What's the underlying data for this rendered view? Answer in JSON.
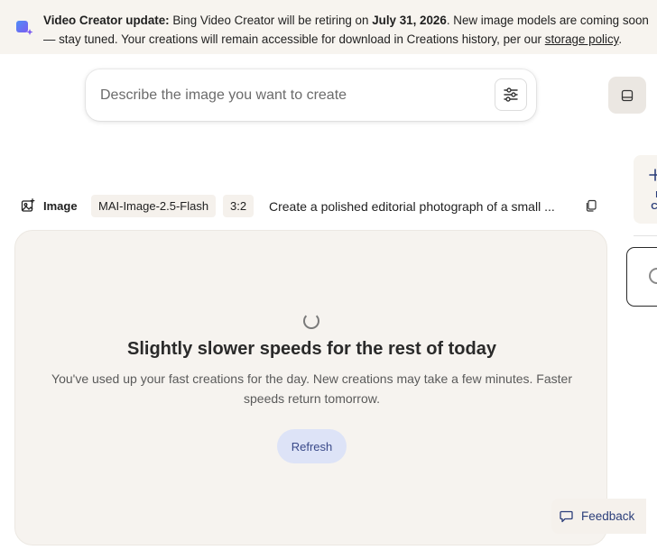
{
  "banner": {
    "bold_lead": "Video Creator update:",
    "text_part1": " Bing Video Creator will be retiring on ",
    "date": "July 31, 2026",
    "text_part2": ". New image models are coming soon — stay tuned. Your creations will remain accessible for download in Creations history, per our ",
    "link_text": "storage policy",
    "text_end": "."
  },
  "prompt": {
    "placeholder": "Describe the image you want to create"
  },
  "creation": {
    "type_label": "Image",
    "model": "MAI-Image-2.5-Flash",
    "aspect_ratio": "3:2",
    "prompt_summary": "Create a polished editorial photograph of a small ..."
  },
  "rail": {
    "new_creation_text": "N\nCre"
  },
  "status": {
    "title": "Slightly slower speeds for the rest of today",
    "description": "You've used up your fast creations for the day. New creations may take a few minutes. Faster speeds return tomorrow.",
    "refresh_label": "Refresh"
  },
  "feedback": {
    "label": "Feedback"
  },
  "colors": {
    "accent": "#2b3e7a",
    "banner_bg": "#f7f4ef",
    "card_bg": "#f6f3ef",
    "refresh_bg": "#dde3f7"
  }
}
